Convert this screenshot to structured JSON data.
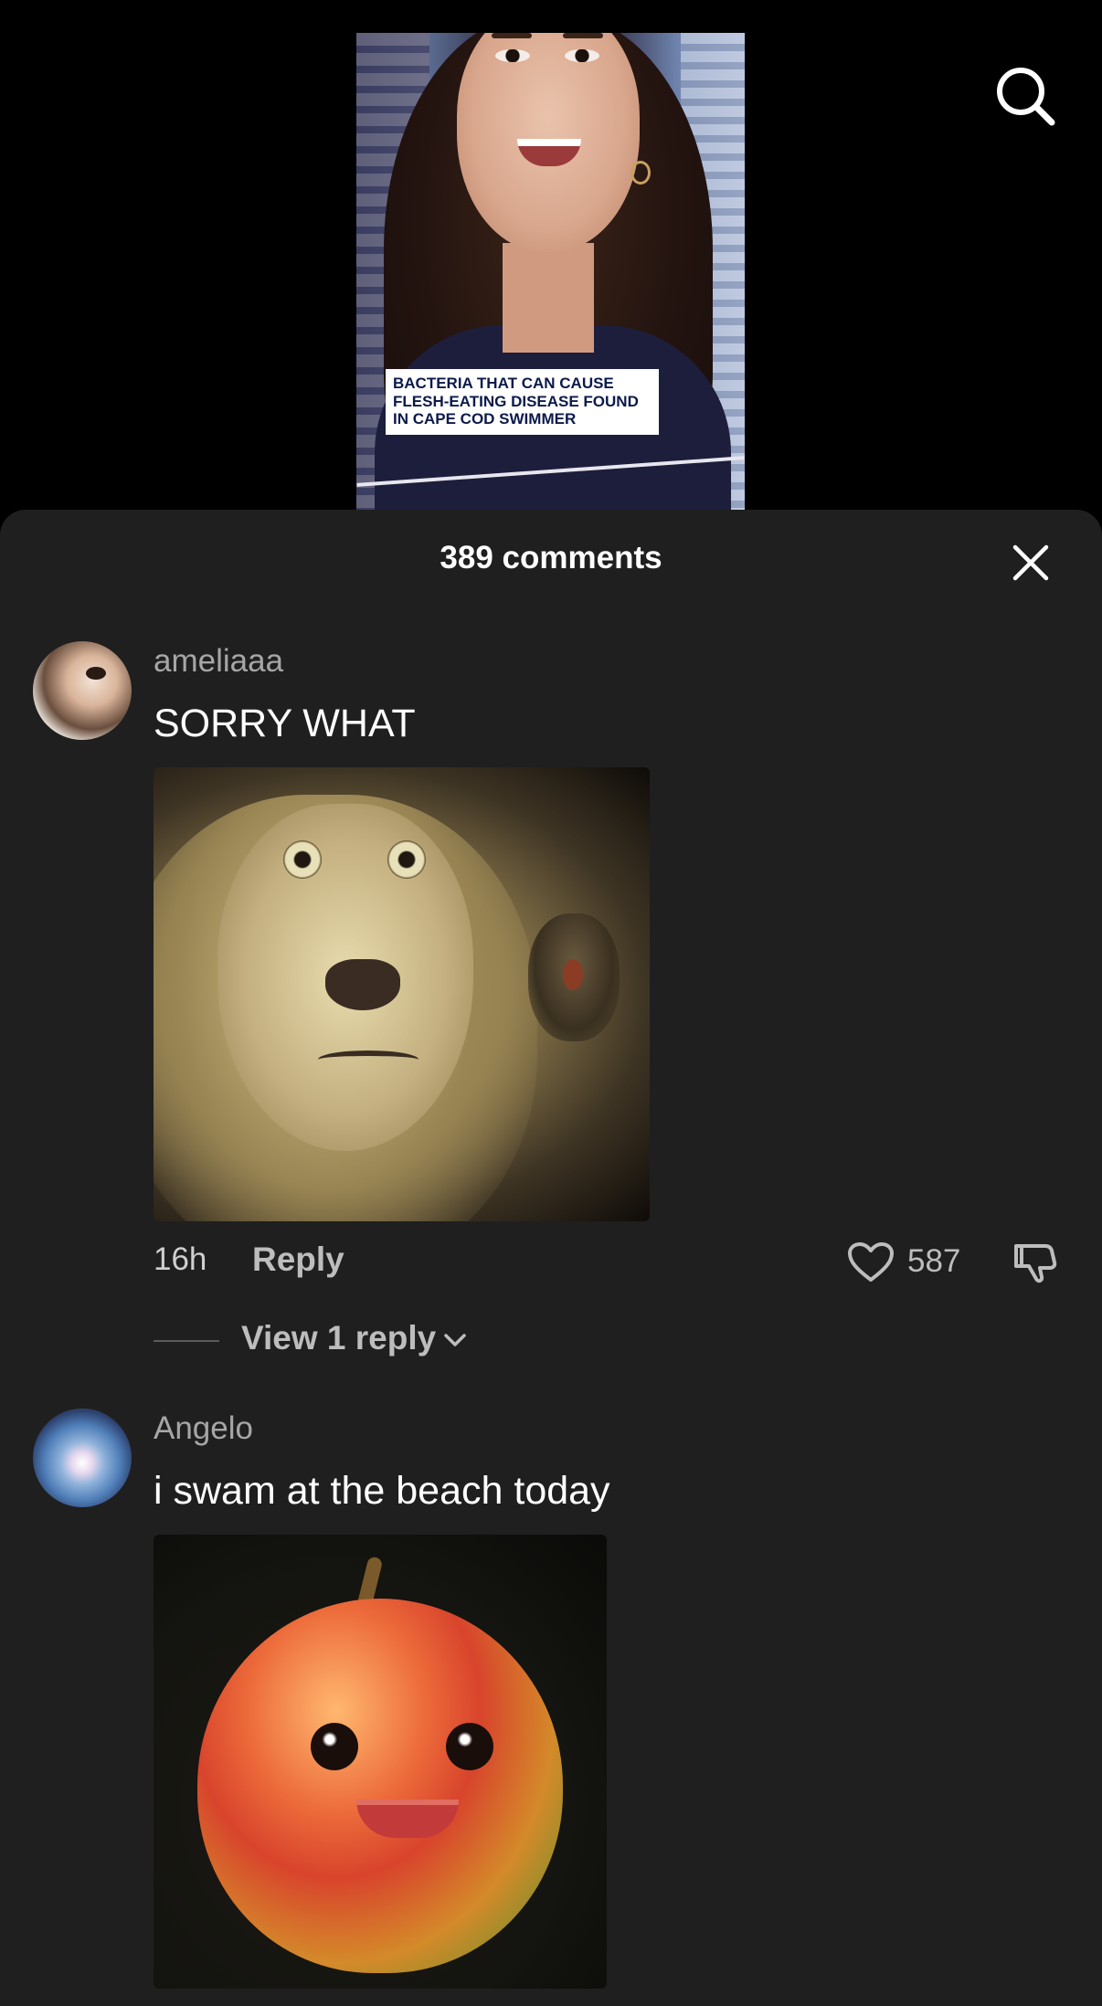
{
  "video": {
    "caption_lines": [
      "BACTERIA THAT CAN CAUSE",
      "FLESH-EATING DISEASE FOUND",
      "IN CAPE COD SWIMMER"
    ]
  },
  "header": {
    "search_icon": "search-icon"
  },
  "comments_panel": {
    "title": "389 comments",
    "close_icon": "close-icon",
    "comments": [
      {
        "username": "ameliaaa",
        "text": "SORRY WHAT",
        "sticker": "shocked-lion-sticker",
        "time": "16h",
        "reply_label": "Reply",
        "likes": "587",
        "view_replies": "View 1 reply"
      },
      {
        "username": "Angelo",
        "text": "i swam at the beach today",
        "sticker": "smiling-mango-sticker"
      }
    ]
  },
  "colors": {
    "background": "#000000",
    "sheet": "#1f1f1f",
    "username": "#a6a6a6",
    "secondary_text": "#bdbdbd"
  }
}
